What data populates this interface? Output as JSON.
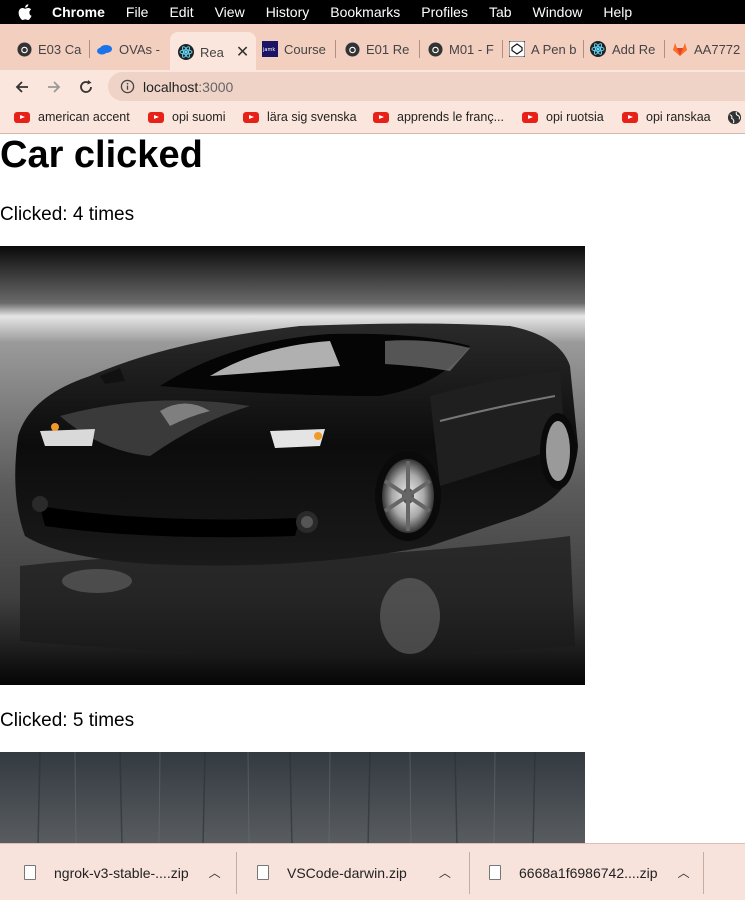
{
  "menubar": {
    "app": "Chrome",
    "items": [
      "File",
      "Edit",
      "View",
      "History",
      "Bookmarks",
      "Profiles",
      "Tab",
      "Window",
      "Help"
    ]
  },
  "tabs": [
    {
      "label": "E03 Ca",
      "icon": "github-icon"
    },
    {
      "label": "OVAs -",
      "icon": "onedrive-icon"
    },
    {
      "label": "Rea",
      "icon": "react-icon",
      "active": true
    },
    {
      "label": "Course",
      "icon": "jamk-icon"
    },
    {
      "label": "E01 Re",
      "icon": "github-icon"
    },
    {
      "label": "M01 - F",
      "icon": "github-icon"
    },
    {
      "label": "A Pen b",
      "icon": "codepen-icon"
    },
    {
      "label": "Add Re",
      "icon": "react-icon"
    },
    {
      "label": "AA7772",
      "icon": "gitlab-icon"
    }
  ],
  "address": {
    "host": "localhost",
    "port": ":3000"
  },
  "bookmarks": [
    "american accent",
    "opi suomi",
    "lära sig svenska",
    "apprends le franç...",
    "opi ruotsia",
    "opi ranskaa"
  ],
  "page": {
    "title": "Car clicked",
    "cars": [
      {
        "clicked_text": "Clicked: 4 times"
      },
      {
        "clicked_text": "Clicked: 5 times"
      }
    ]
  },
  "downloads": [
    {
      "name": "ngrok-v3-stable-....zip"
    },
    {
      "name": "VSCode-darwin.zip"
    },
    {
      "name": "6668a1f6986742....zip"
    }
  ],
  "colors": {
    "tabstrip": "#f3cfc0",
    "toolbar": "#fbe6dd",
    "youtube": "#e62117"
  }
}
